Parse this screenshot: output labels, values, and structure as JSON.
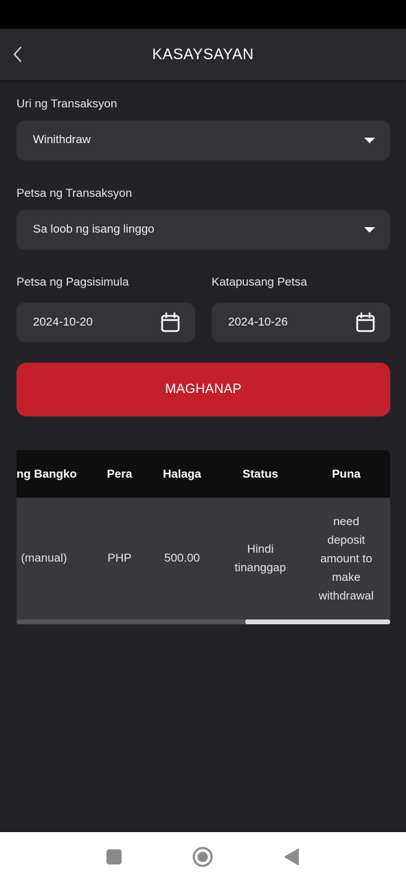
{
  "header": {
    "title": "KASAYSAYAN",
    "back_icon": "chevron-left-icon"
  },
  "filters": {
    "type_label": "Uri ng Transaksyon",
    "type_value": "Winithdraw",
    "date_label": "Petsa ng Transaksyon",
    "date_value": "Sa loob ng isang linggo",
    "start_label": "Petsa ng Pagsisimula",
    "start_value": "2024-10-20",
    "end_label": "Katapusang Petsa",
    "end_value": "2024-10-26",
    "calendar_icon": "calendar-icon"
  },
  "search_button": {
    "label": "MAGHANAP",
    "color": "#c4202a"
  },
  "table": {
    "columns": [
      "ng Bangko",
      "Pera",
      "Halaga",
      "Status",
      "Puna"
    ],
    "rows": [
      {
        "bank": "(manual)",
        "currency": "PHP",
        "amount": "500.00",
        "status_line1": "Hindi",
        "status_line2": "tinanggap",
        "note_line1": "need",
        "note_line2": "deposit",
        "note_line3": "amount to",
        "note_line4": "make",
        "note_line5": "withdrawal"
      }
    ]
  },
  "nav": {
    "recent_icon": "square-icon",
    "home_icon": "circle-home-icon",
    "back_icon": "triangle-back-icon"
  }
}
